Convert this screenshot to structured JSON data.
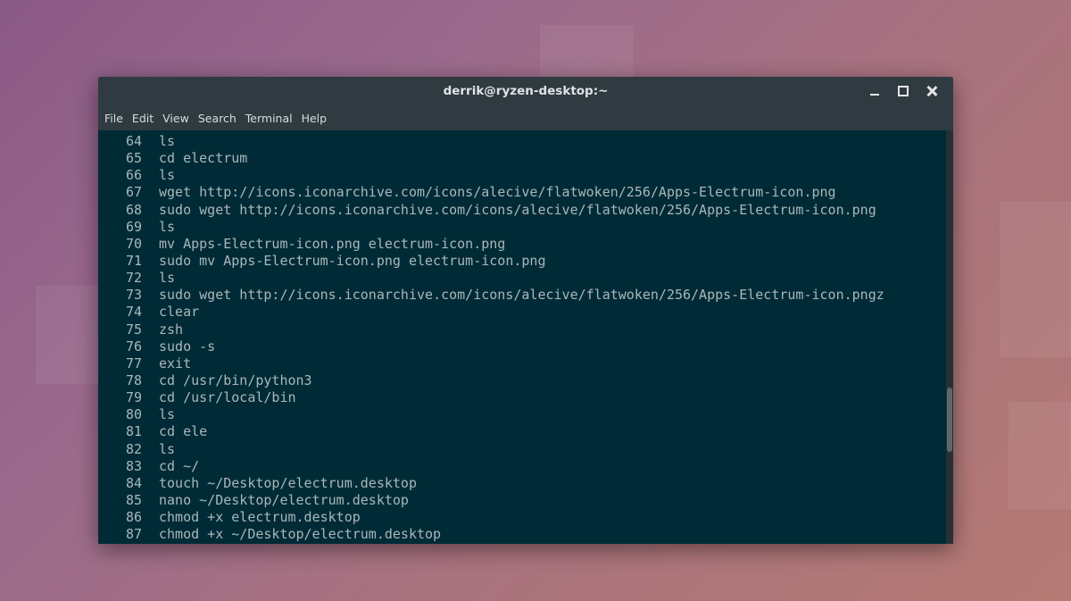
{
  "window": {
    "title": "derrik@ryzen-desktop:~"
  },
  "menu": [
    "File",
    "Edit",
    "View",
    "Search",
    "Terminal",
    "Help"
  ],
  "history": [
    {
      "n": "64",
      "cmd": "ls"
    },
    {
      "n": "65",
      "cmd": "cd electrum"
    },
    {
      "n": "66",
      "cmd": "ls"
    },
    {
      "n": "67",
      "cmd": "wget http://icons.iconarchive.com/icons/alecive/flatwoken/256/Apps-Electrum-icon.png"
    },
    {
      "n": "68",
      "cmd": "sudo wget http://icons.iconarchive.com/icons/alecive/flatwoken/256/Apps-Electrum-icon.png"
    },
    {
      "n": "69",
      "cmd": "ls"
    },
    {
      "n": "70",
      "cmd": "mv Apps-Electrum-icon.png electrum-icon.png"
    },
    {
      "n": "71",
      "cmd": "sudo mv Apps-Electrum-icon.png electrum-icon.png"
    },
    {
      "n": "72",
      "cmd": "ls"
    },
    {
      "n": "73",
      "cmd": "sudo wget http://icons.iconarchive.com/icons/alecive/flatwoken/256/Apps-Electrum-icon.pngz"
    },
    {
      "n": "74",
      "cmd": "clear"
    },
    {
      "n": "75",
      "cmd": "zsh"
    },
    {
      "n": "76",
      "cmd": "sudo -s"
    },
    {
      "n": "77",
      "cmd": "exit"
    },
    {
      "n": "78",
      "cmd": "cd /usr/bin/python3"
    },
    {
      "n": "79",
      "cmd": "cd /usr/local/bin"
    },
    {
      "n": "80",
      "cmd": "ls"
    },
    {
      "n": "81",
      "cmd": "cd ele"
    },
    {
      "n": "82",
      "cmd": "ls"
    },
    {
      "n": "83",
      "cmd": "cd ~/"
    },
    {
      "n": "84",
      "cmd": "touch ~/Desktop/electrum.desktop"
    },
    {
      "n": "85",
      "cmd": "nano ~/Desktop/electrum.desktop"
    },
    {
      "n": "86",
      "cmd": "chmod +x electrum.desktop"
    },
    {
      "n": "87",
      "cmd": "chmod +x ~/Desktop/electrum.desktop"
    }
  ],
  "icons": {
    "minimize": "minimize-icon",
    "maximize": "maximize-icon",
    "close": "close-icon"
  },
  "colors": {
    "terminal_bg": "#002b36",
    "terminal_fg": "#a9b7bb",
    "titlebar_bg": "#2f3b40"
  }
}
